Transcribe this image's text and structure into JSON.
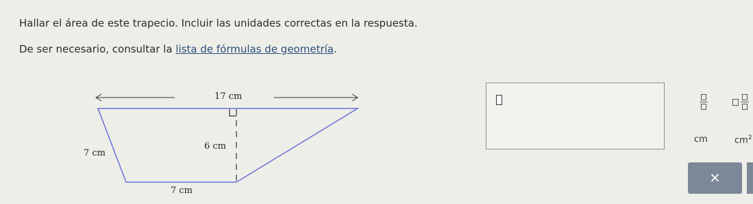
{
  "question": {
    "line1": "Hallar el área de este trapecio. Incluir las unidades correctas en la respuesta.",
    "line2_prefix": "De ser necesario, consultar la ",
    "link": "lista de fórmulas de geometría",
    "line2_suffix": "."
  },
  "figure": {
    "top_label": "17 cm",
    "left_label": "7 cm",
    "height_label": "6 cm",
    "bottom_label": "7 cm"
  },
  "keypad": {
    "unit1": "cm",
    "unit2": "cm",
    "unit2_exponent": "2",
    "clear_symbol": "×"
  },
  "colors": {
    "trapezoid_stroke": "#6a70d8",
    "button_bg": "#7c8797"
  }
}
